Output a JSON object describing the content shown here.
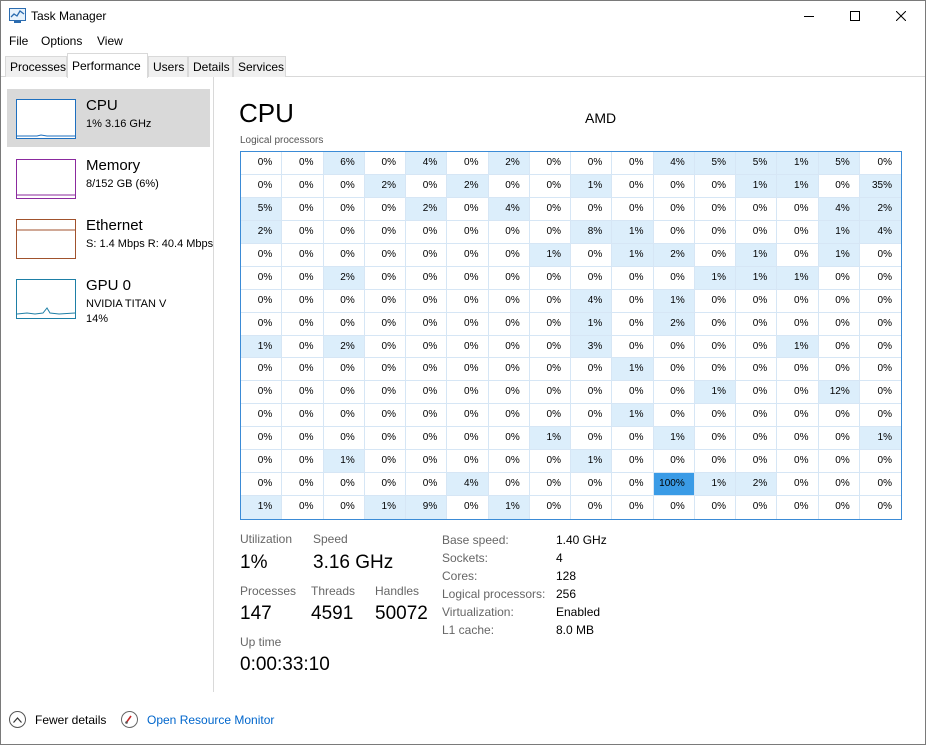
{
  "window": {
    "title": "Task Manager"
  },
  "menu": [
    "File",
    "Options",
    "View"
  ],
  "tabs": [
    "Processes",
    "Performance",
    "Users",
    "Details",
    "Services"
  ],
  "sidebar": {
    "items": [
      {
        "title": "CPU",
        "sub": "1% 3.16 GHz",
        "sub2": "",
        "color": "#1e6fbf"
      },
      {
        "title": "Memory",
        "sub": "8/152 GB (6%)",
        "sub2": "",
        "color": "#8b2a9e"
      },
      {
        "title": "Ethernet",
        "sub": "S: 1.4 Mbps R: 40.4 Mbps",
        "sub2": "",
        "color": "#a0522d"
      },
      {
        "title": "GPU 0",
        "sub": "NVIDIA TITAN V",
        "sub2": "14%",
        "color": "#1e7fa6"
      }
    ]
  },
  "main": {
    "title": "CPU",
    "cpu_name": "AMD",
    "grid_label": "Logical processors",
    "grid": [
      [
        "0%",
        "0%",
        "6%",
        "0%",
        "4%",
        "0%",
        "2%",
        "0%",
        "0%",
        "0%",
        "4%",
        "5%",
        "5%",
        "1%",
        "5%",
        "0%"
      ],
      [
        "0%",
        "0%",
        "0%",
        "2%",
        "0%",
        "2%",
        "0%",
        "0%",
        "1%",
        "0%",
        "0%",
        "0%",
        "1%",
        "1%",
        "0%",
        "35%"
      ],
      [
        "5%",
        "0%",
        "0%",
        "0%",
        "2%",
        "0%",
        "4%",
        "0%",
        "0%",
        "0%",
        "0%",
        "0%",
        "0%",
        "0%",
        "4%",
        "2%"
      ],
      [
        "2%",
        "0%",
        "0%",
        "0%",
        "0%",
        "0%",
        "0%",
        "0%",
        "8%",
        "1%",
        "0%",
        "0%",
        "0%",
        "0%",
        "1%",
        "4%"
      ],
      [
        "0%",
        "0%",
        "0%",
        "0%",
        "0%",
        "0%",
        "0%",
        "1%",
        "0%",
        "1%",
        "2%",
        "0%",
        "1%",
        "0%",
        "1%",
        "0%"
      ],
      [
        "0%",
        "0%",
        "2%",
        "0%",
        "0%",
        "0%",
        "0%",
        "0%",
        "0%",
        "0%",
        "0%",
        "1%",
        "1%",
        "1%",
        "0%",
        "0%"
      ],
      [
        "0%",
        "0%",
        "0%",
        "0%",
        "0%",
        "0%",
        "0%",
        "0%",
        "4%",
        "0%",
        "1%",
        "0%",
        "0%",
        "0%",
        "0%",
        "0%"
      ],
      [
        "0%",
        "0%",
        "0%",
        "0%",
        "0%",
        "0%",
        "0%",
        "0%",
        "1%",
        "0%",
        "2%",
        "0%",
        "0%",
        "0%",
        "0%",
        "0%"
      ],
      [
        "1%",
        "0%",
        "2%",
        "0%",
        "0%",
        "0%",
        "0%",
        "0%",
        "3%",
        "0%",
        "0%",
        "0%",
        "0%",
        "1%",
        "0%",
        "0%"
      ],
      [
        "0%",
        "0%",
        "0%",
        "0%",
        "0%",
        "0%",
        "0%",
        "0%",
        "0%",
        "1%",
        "0%",
        "0%",
        "0%",
        "0%",
        "0%",
        "0%"
      ],
      [
        "0%",
        "0%",
        "0%",
        "0%",
        "0%",
        "0%",
        "0%",
        "0%",
        "0%",
        "0%",
        "0%",
        "1%",
        "0%",
        "0%",
        "12%",
        "0%"
      ],
      [
        "0%",
        "0%",
        "0%",
        "0%",
        "0%",
        "0%",
        "0%",
        "0%",
        "0%",
        "1%",
        "0%",
        "0%",
        "0%",
        "0%",
        "0%",
        "0%"
      ],
      [
        "0%",
        "0%",
        "0%",
        "0%",
        "0%",
        "0%",
        "0%",
        "1%",
        "0%",
        "0%",
        "1%",
        "0%",
        "0%",
        "0%",
        "0%",
        "1%"
      ],
      [
        "0%",
        "0%",
        "1%",
        "0%",
        "0%",
        "0%",
        "0%",
        "0%",
        "1%",
        "0%",
        "0%",
        "0%",
        "0%",
        "0%",
        "0%",
        "0%"
      ],
      [
        "0%",
        "0%",
        "0%",
        "0%",
        "0%",
        "4%",
        "0%",
        "0%",
        "0%",
        "0%",
        "100%",
        "1%",
        "2%",
        "0%",
        "0%",
        "0%"
      ],
      [
        "1%",
        "0%",
        "0%",
        "1%",
        "9%",
        "0%",
        "1%",
        "0%",
        "0%",
        "0%",
        "0%",
        "0%",
        "0%",
        "0%",
        "0%",
        "0%"
      ]
    ],
    "stats": {
      "utilization_label": "Utilization",
      "utilization": "1%",
      "speed_label": "Speed",
      "speed": "3.16 GHz",
      "processes_label": "Processes",
      "processes": "147",
      "threads_label": "Threads",
      "threads": "4591",
      "handles_label": "Handles",
      "handles": "50072",
      "uptime_label": "Up time",
      "uptime": "0:00:33:10"
    },
    "specs": [
      {
        "key": "Base speed:",
        "value": "1.40 GHz"
      },
      {
        "key": "Sockets:",
        "value": "4"
      },
      {
        "key": "Cores:",
        "value": "128"
      },
      {
        "key": "Logical processors:",
        "value": "256"
      },
      {
        "key": "Virtualization:",
        "value": "Enabled"
      },
      {
        "key": "L1 cache:",
        "value": "8.0 MB"
      }
    ]
  },
  "footer": {
    "fewer": "Fewer details",
    "monitor": "Open Resource Monitor"
  },
  "colors": {
    "accent": "#1e6fbf",
    "light_cell": "#dceefb",
    "mid_cell": "#c6e2f8",
    "hot_cell": "#3a9be6"
  }
}
